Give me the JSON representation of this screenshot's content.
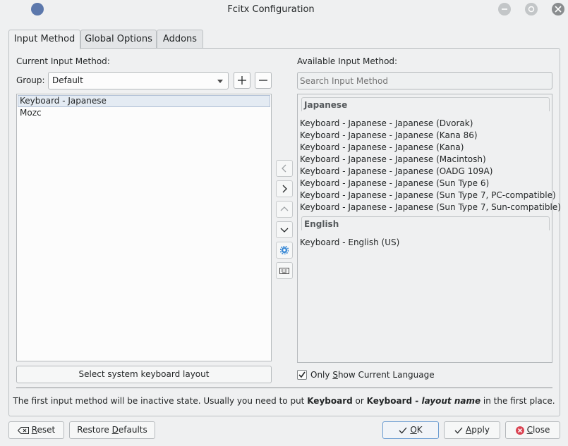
{
  "window": {
    "title": "Fcitx Configuration"
  },
  "tabs": [
    {
      "label": "Input Method",
      "active": true
    },
    {
      "label": "Global Options",
      "active": false
    },
    {
      "label": "Addons",
      "active": false
    }
  ],
  "current": {
    "heading": "Current Input Method:",
    "group_label": "Group:",
    "group_value": "Default",
    "items": [
      {
        "label": "Keyboard - Japanese",
        "selected": true
      },
      {
        "label": "Mozc",
        "selected": false
      }
    ],
    "select_layout_button": "Select system keyboard layout"
  },
  "available": {
    "heading": "Available Input Method:",
    "search_placeholder": "Search Input Method",
    "categories": [
      {
        "name": "Japanese",
        "items": [
          "Keyboard - Japanese - Japanese (Dvorak)",
          "Keyboard - Japanese - Japanese (Kana 86)",
          "Keyboard - Japanese - Japanese (Kana)",
          "Keyboard - Japanese - Japanese (Macintosh)",
          "Keyboard - Japanese - Japanese (OADG 109A)",
          "Keyboard - Japanese - Japanese (Sun Type 6)",
          "Keyboard - Japanese - Japanese (Sun Type 7, PC-compatible)",
          "Keyboard - Japanese - Japanese (Sun Type 7, Sun-compatible)"
        ]
      },
      {
        "name": "English",
        "items": [
          "Keyboard - English (US)"
        ]
      }
    ],
    "only_current_language": {
      "checked": true,
      "label_pre": "Only ",
      "label_mnemonic": "S",
      "label_post": "how Current Language"
    }
  },
  "info": {
    "text1": "The first input method will be inactive state. Usually you need to put ",
    "bold1": "Keyboard",
    "text2": " or ",
    "bold2": "Keyboard - ",
    "italic": "layout name",
    "text3": " in the first place."
  },
  "footer": {
    "reset_mnemonic": "R",
    "reset_rest": "eset",
    "restore_pre": "Restore ",
    "restore_mnemonic": "D",
    "restore_post": "efaults",
    "ok_mnemonic": "O",
    "ok_rest": "K",
    "apply_mnemonic": "A",
    "apply_rest": "pply",
    "close_mnemonic": "C",
    "close_rest": "lose"
  },
  "colors": {
    "accent": "#3daee9",
    "close_icon": "#da4453",
    "app_icon": "#5c78ac"
  }
}
